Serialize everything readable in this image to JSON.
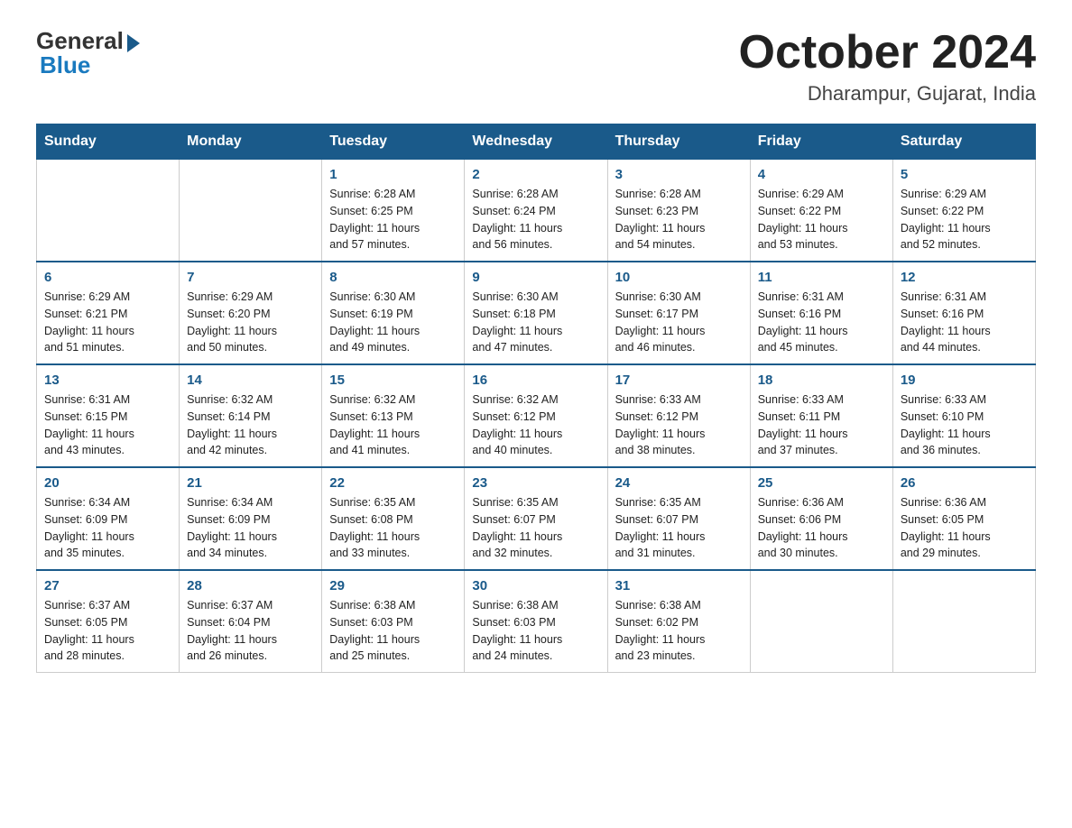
{
  "header": {
    "logo_general": "General",
    "logo_blue": "Blue",
    "month_title": "October 2024",
    "location": "Dharampur, Gujarat, India"
  },
  "weekdays": [
    "Sunday",
    "Monday",
    "Tuesday",
    "Wednesday",
    "Thursday",
    "Friday",
    "Saturday"
  ],
  "weeks": [
    [
      {
        "day": "",
        "info": ""
      },
      {
        "day": "",
        "info": ""
      },
      {
        "day": "1",
        "info": "Sunrise: 6:28 AM\nSunset: 6:25 PM\nDaylight: 11 hours\nand 57 minutes."
      },
      {
        "day": "2",
        "info": "Sunrise: 6:28 AM\nSunset: 6:24 PM\nDaylight: 11 hours\nand 56 minutes."
      },
      {
        "day": "3",
        "info": "Sunrise: 6:28 AM\nSunset: 6:23 PM\nDaylight: 11 hours\nand 54 minutes."
      },
      {
        "day": "4",
        "info": "Sunrise: 6:29 AM\nSunset: 6:22 PM\nDaylight: 11 hours\nand 53 minutes."
      },
      {
        "day": "5",
        "info": "Sunrise: 6:29 AM\nSunset: 6:22 PM\nDaylight: 11 hours\nand 52 minutes."
      }
    ],
    [
      {
        "day": "6",
        "info": "Sunrise: 6:29 AM\nSunset: 6:21 PM\nDaylight: 11 hours\nand 51 minutes."
      },
      {
        "day": "7",
        "info": "Sunrise: 6:29 AM\nSunset: 6:20 PM\nDaylight: 11 hours\nand 50 minutes."
      },
      {
        "day": "8",
        "info": "Sunrise: 6:30 AM\nSunset: 6:19 PM\nDaylight: 11 hours\nand 49 minutes."
      },
      {
        "day": "9",
        "info": "Sunrise: 6:30 AM\nSunset: 6:18 PM\nDaylight: 11 hours\nand 47 minutes."
      },
      {
        "day": "10",
        "info": "Sunrise: 6:30 AM\nSunset: 6:17 PM\nDaylight: 11 hours\nand 46 minutes."
      },
      {
        "day": "11",
        "info": "Sunrise: 6:31 AM\nSunset: 6:16 PM\nDaylight: 11 hours\nand 45 minutes."
      },
      {
        "day": "12",
        "info": "Sunrise: 6:31 AM\nSunset: 6:16 PM\nDaylight: 11 hours\nand 44 minutes."
      }
    ],
    [
      {
        "day": "13",
        "info": "Sunrise: 6:31 AM\nSunset: 6:15 PM\nDaylight: 11 hours\nand 43 minutes."
      },
      {
        "day": "14",
        "info": "Sunrise: 6:32 AM\nSunset: 6:14 PM\nDaylight: 11 hours\nand 42 minutes."
      },
      {
        "day": "15",
        "info": "Sunrise: 6:32 AM\nSunset: 6:13 PM\nDaylight: 11 hours\nand 41 minutes."
      },
      {
        "day": "16",
        "info": "Sunrise: 6:32 AM\nSunset: 6:12 PM\nDaylight: 11 hours\nand 40 minutes."
      },
      {
        "day": "17",
        "info": "Sunrise: 6:33 AM\nSunset: 6:12 PM\nDaylight: 11 hours\nand 38 minutes."
      },
      {
        "day": "18",
        "info": "Sunrise: 6:33 AM\nSunset: 6:11 PM\nDaylight: 11 hours\nand 37 minutes."
      },
      {
        "day": "19",
        "info": "Sunrise: 6:33 AM\nSunset: 6:10 PM\nDaylight: 11 hours\nand 36 minutes."
      }
    ],
    [
      {
        "day": "20",
        "info": "Sunrise: 6:34 AM\nSunset: 6:09 PM\nDaylight: 11 hours\nand 35 minutes."
      },
      {
        "day": "21",
        "info": "Sunrise: 6:34 AM\nSunset: 6:09 PM\nDaylight: 11 hours\nand 34 minutes."
      },
      {
        "day": "22",
        "info": "Sunrise: 6:35 AM\nSunset: 6:08 PM\nDaylight: 11 hours\nand 33 minutes."
      },
      {
        "day": "23",
        "info": "Sunrise: 6:35 AM\nSunset: 6:07 PM\nDaylight: 11 hours\nand 32 minutes."
      },
      {
        "day": "24",
        "info": "Sunrise: 6:35 AM\nSunset: 6:07 PM\nDaylight: 11 hours\nand 31 minutes."
      },
      {
        "day": "25",
        "info": "Sunrise: 6:36 AM\nSunset: 6:06 PM\nDaylight: 11 hours\nand 30 minutes."
      },
      {
        "day": "26",
        "info": "Sunrise: 6:36 AM\nSunset: 6:05 PM\nDaylight: 11 hours\nand 29 minutes."
      }
    ],
    [
      {
        "day": "27",
        "info": "Sunrise: 6:37 AM\nSunset: 6:05 PM\nDaylight: 11 hours\nand 28 minutes."
      },
      {
        "day": "28",
        "info": "Sunrise: 6:37 AM\nSunset: 6:04 PM\nDaylight: 11 hours\nand 26 minutes."
      },
      {
        "day": "29",
        "info": "Sunrise: 6:38 AM\nSunset: 6:03 PM\nDaylight: 11 hours\nand 25 minutes."
      },
      {
        "day": "30",
        "info": "Sunrise: 6:38 AM\nSunset: 6:03 PM\nDaylight: 11 hours\nand 24 minutes."
      },
      {
        "day": "31",
        "info": "Sunrise: 6:38 AM\nSunset: 6:02 PM\nDaylight: 11 hours\nand 23 minutes."
      },
      {
        "day": "",
        "info": ""
      },
      {
        "day": "",
        "info": ""
      }
    ]
  ]
}
